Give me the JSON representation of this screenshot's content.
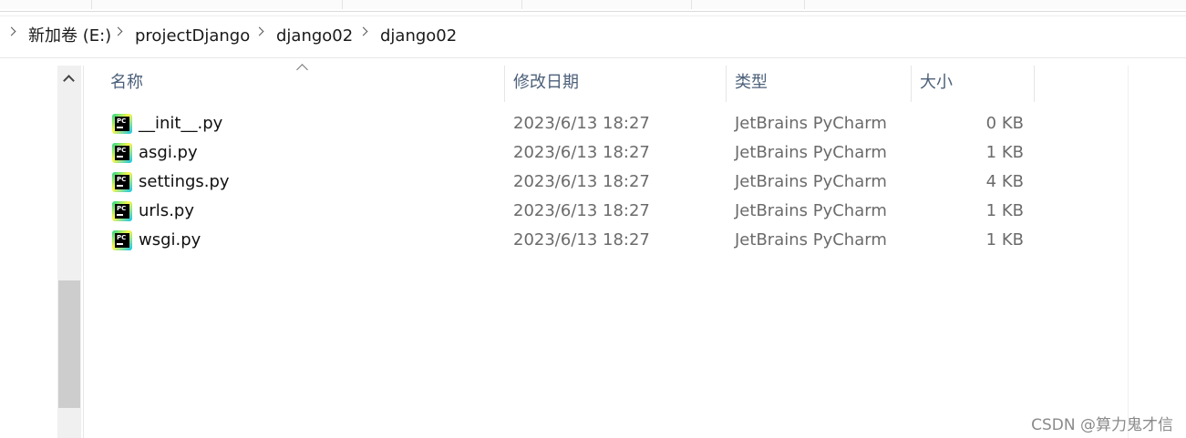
{
  "breadcrumb": {
    "items": [
      "新加卷 (E:)",
      "projectDjango",
      "django02",
      "django02"
    ]
  },
  "columns": {
    "name": "名称",
    "modified": "修改日期",
    "type": "类型",
    "size": "大小"
  },
  "files": [
    {
      "name": "__init__.py",
      "modified": "2023/6/13 18:27",
      "type": "JetBrains PyCharm",
      "size": "0 KB"
    },
    {
      "name": "asgi.py",
      "modified": "2023/6/13 18:27",
      "type": "JetBrains PyCharm",
      "size": "1 KB"
    },
    {
      "name": "settings.py",
      "modified": "2023/6/13 18:27",
      "type": "JetBrains PyCharm",
      "size": "4 KB"
    },
    {
      "name": "urls.py",
      "modified": "2023/6/13 18:27",
      "type": "JetBrains PyCharm",
      "size": "1 KB"
    },
    {
      "name": "wsgi.py",
      "modified": "2023/6/13 18:27",
      "type": "JetBrains PyCharm",
      "size": "1 KB"
    }
  ],
  "icons": {
    "file_icon": "pycharm-file-icon",
    "icon_label": "PC",
    "scroll_up": "chevron-up-icon",
    "sort": "sort-ascending-icon"
  },
  "watermark": "CSDN @算力鬼才信"
}
